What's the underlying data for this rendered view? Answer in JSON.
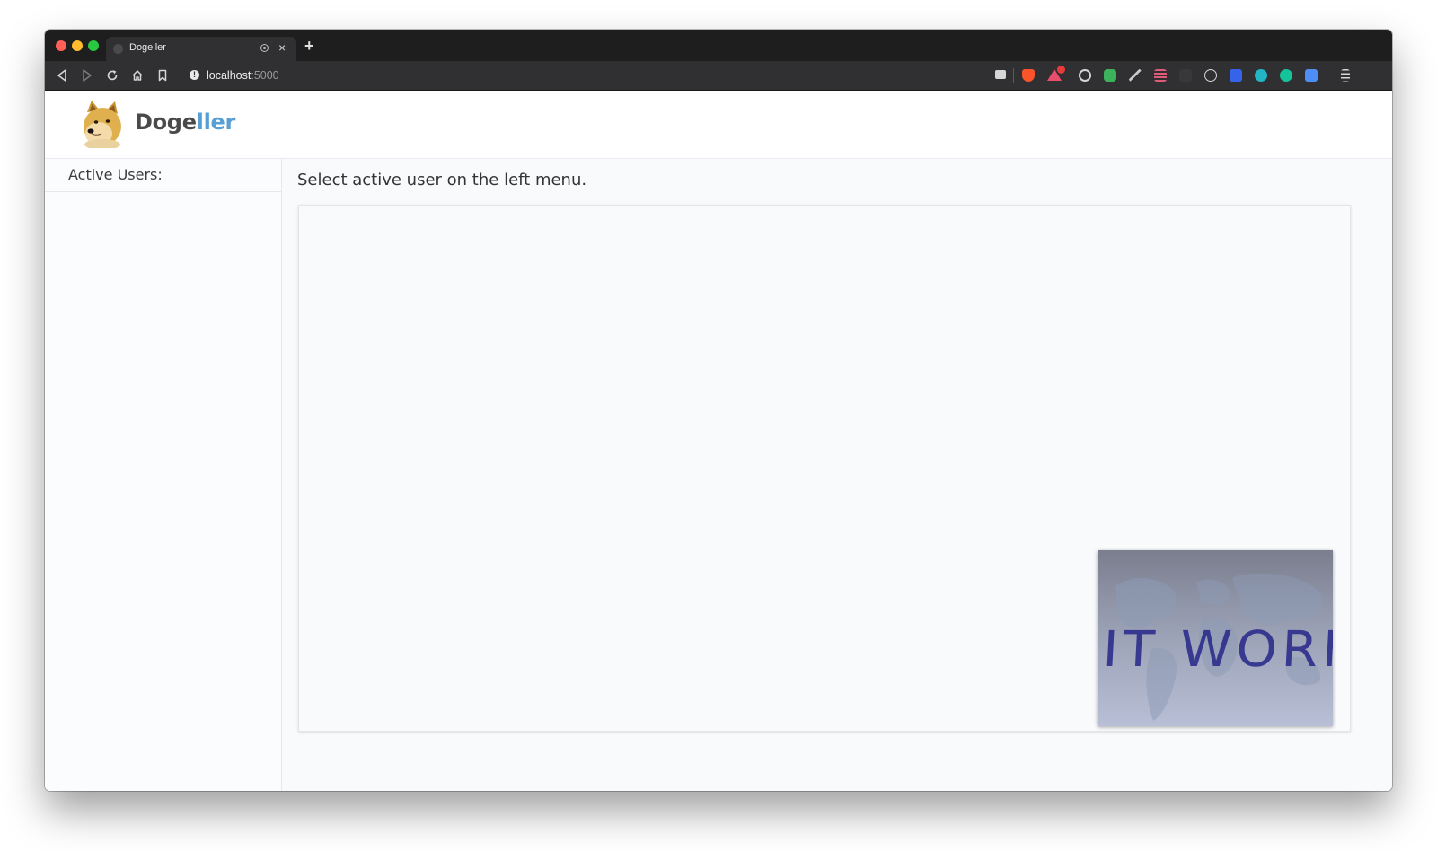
{
  "browser": {
    "tab_title": "Dogeller",
    "url_host": "localhost",
    "url_port": ":5000",
    "new_tab_label": "+",
    "close_label": "×"
  },
  "app": {
    "brand_part1": "Doge",
    "brand_part2": "ller",
    "brand_colors": {
      "primary": "#4a4a4a",
      "accent": "#5a9fd4"
    }
  },
  "sidebar": {
    "title": "Active Users:"
  },
  "main": {
    "prompt": "Select active user on the left menu."
  },
  "self_video": {
    "sign_text": "IT WORKS"
  },
  "icons": [
    "back-icon",
    "forward-icon",
    "reload-icon",
    "home-icon",
    "bookmark-icon",
    "info-icon",
    "camera-icon",
    "brave-shield-icon",
    "rewards-icon",
    "menu-icon"
  ]
}
